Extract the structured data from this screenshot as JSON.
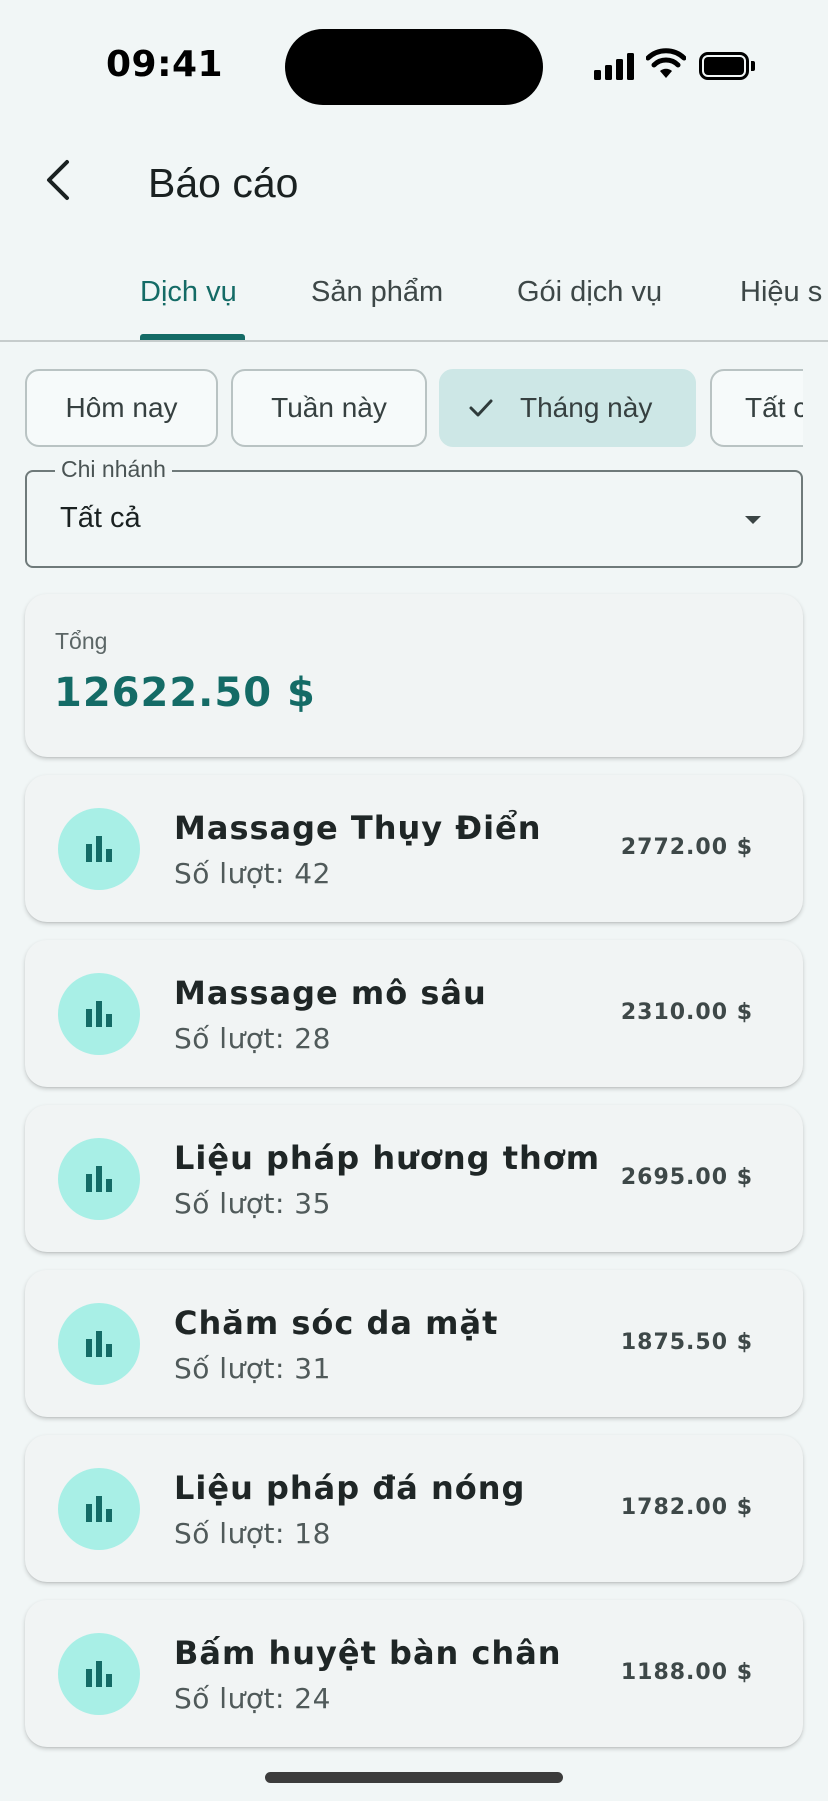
{
  "status_bar": {
    "time": "09:41"
  },
  "app_bar": {
    "title": "Báo cáo"
  },
  "tabs": [
    {
      "label": "Dịch vụ",
      "active": true
    },
    {
      "label": "Sản phẩm",
      "active": false
    },
    {
      "label": "Gói dịch vụ",
      "active": false
    },
    {
      "label": "Hiệu s",
      "active": false
    }
  ],
  "filters": [
    {
      "label": "Hôm nay",
      "selected": false
    },
    {
      "label": "Tuần này",
      "selected": false
    },
    {
      "label": "Tháng này",
      "selected": true
    },
    {
      "label": "Tất c",
      "selected": false
    }
  ],
  "branch": {
    "label": "Chi nhánh",
    "value": "Tất cả"
  },
  "total": {
    "label": "Tổng",
    "value": "12622.50 $"
  },
  "services": [
    {
      "name": "Massage Thụy Điển",
      "count": "Số lượt: 42",
      "amount": "2772.00 $"
    },
    {
      "name": "Massage mô sâu",
      "count": "Số lượt: 28",
      "amount": "2310.00 $"
    },
    {
      "name": "Liệu pháp hương thơm",
      "count": "Số lượt: 35",
      "amount": "2695.00 $"
    },
    {
      "name": "Chăm sóc da mặt",
      "count": "Số lượt: 31",
      "amount": "1875.50 $"
    },
    {
      "name": "Liệu pháp đá nóng",
      "count": "Số lượt: 18",
      "amount": "1782.00 $"
    },
    {
      "name": "Bấm huyệt bàn chân",
      "count": "Số lượt: 24",
      "amount": "1188.00 $"
    }
  ],
  "colors": {
    "accent": "#146b66",
    "icon_bg": "#a8efe6",
    "chip_selected": "#cde7e6"
  }
}
